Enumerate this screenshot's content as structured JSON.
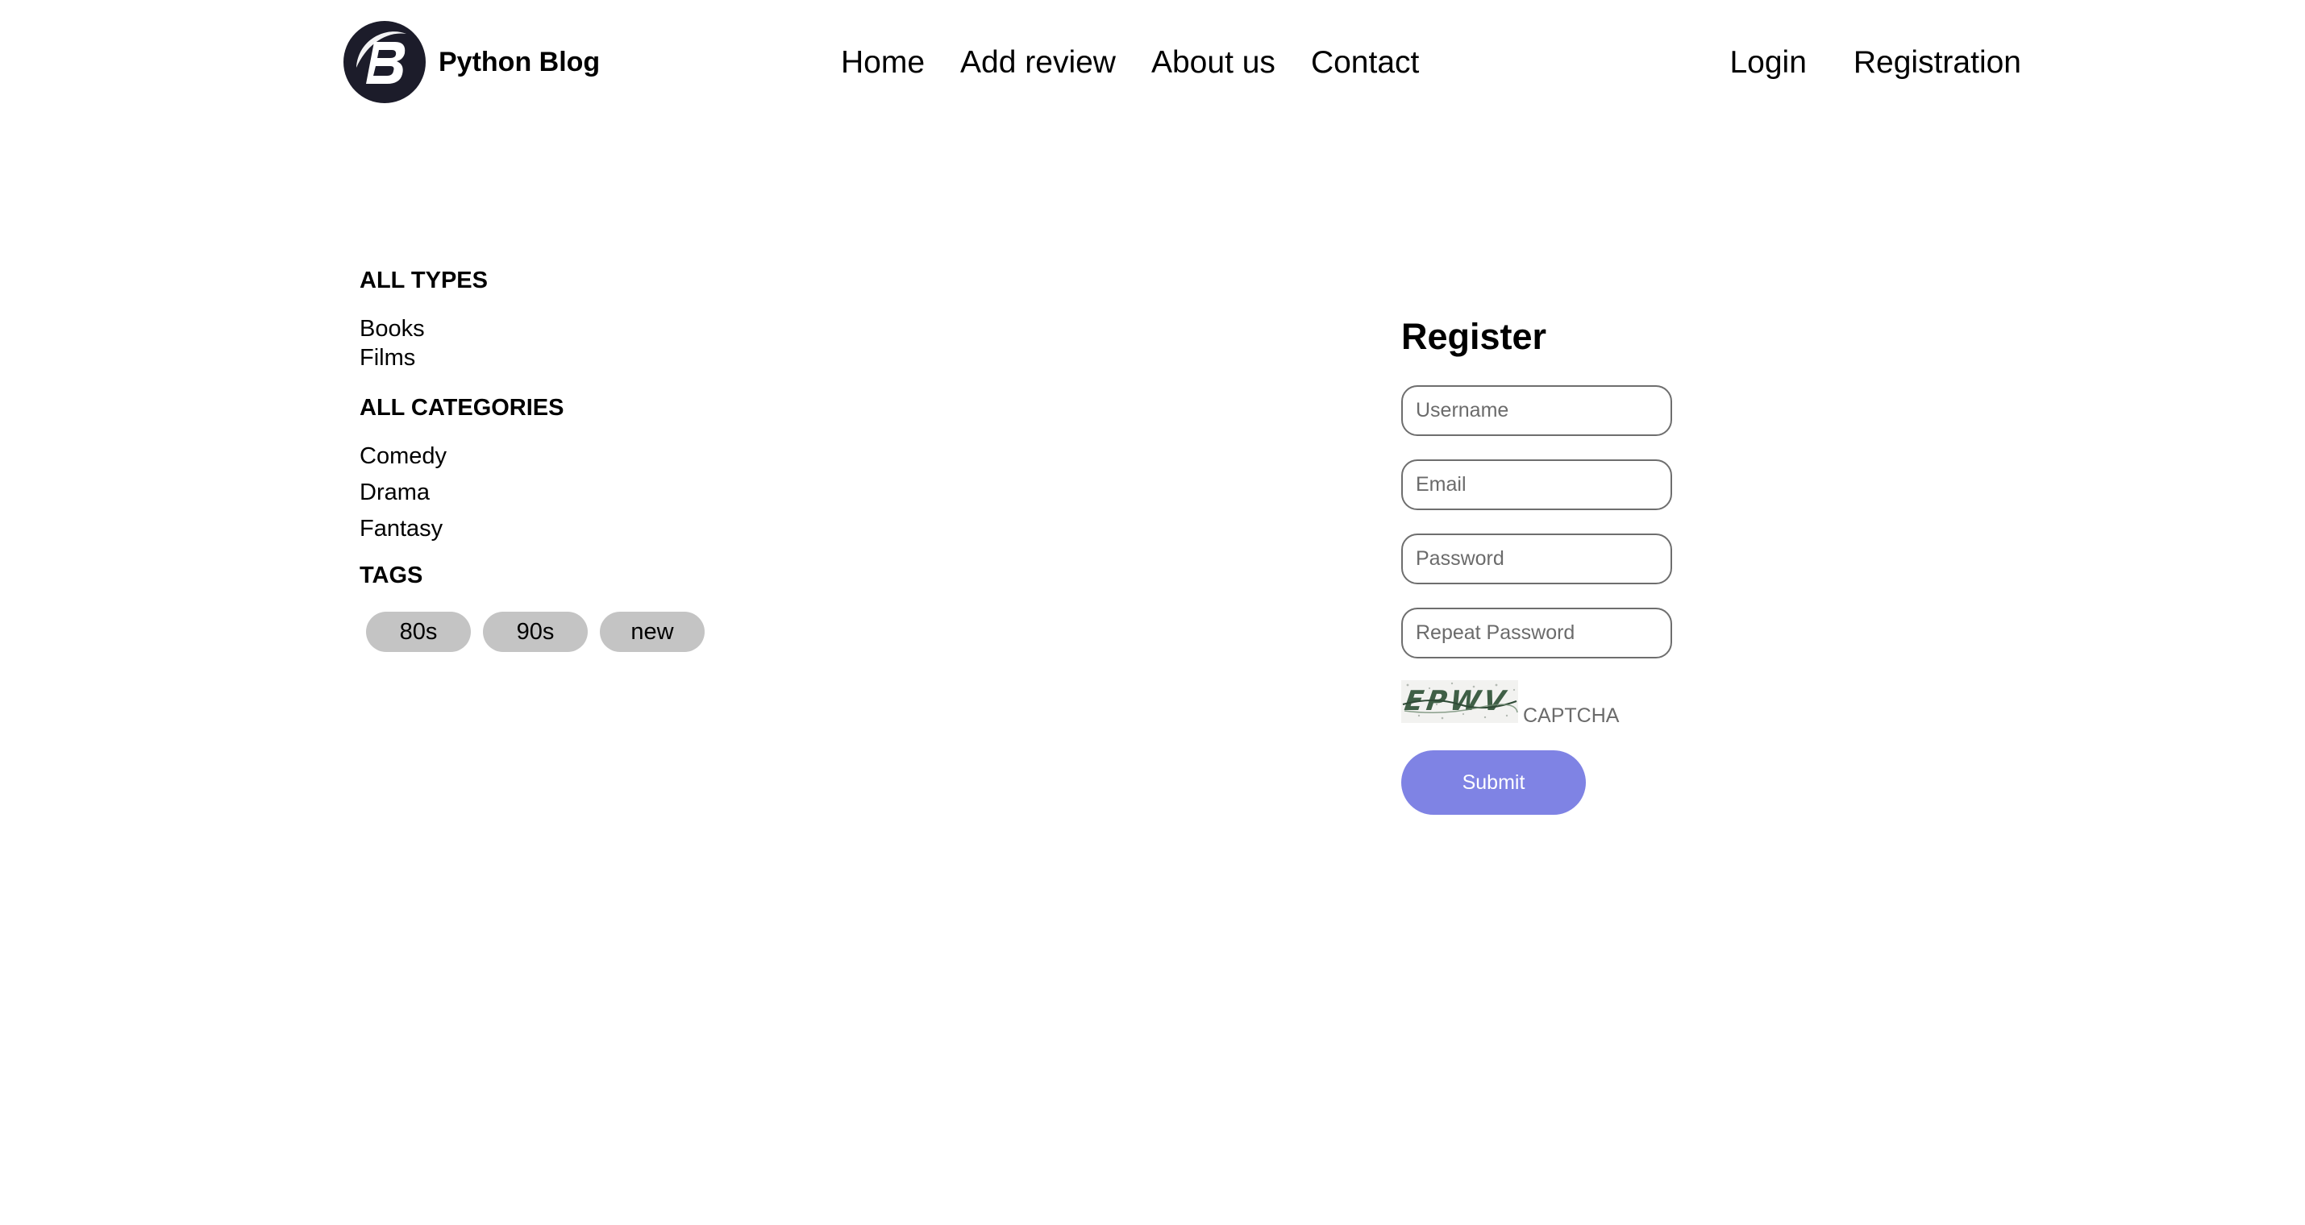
{
  "header": {
    "brand_name": "Python Blog",
    "logo_icon": "letter-b-logo-icon",
    "nav": [
      {
        "label": "Home"
      },
      {
        "label": "Add review"
      },
      {
        "label": "About us"
      },
      {
        "label": "Contact"
      }
    ],
    "auth": {
      "login_label": "Login",
      "registration_label": "Registration"
    }
  },
  "sidebar": {
    "types_heading": "ALL TYPES",
    "types": [
      {
        "label": "Books"
      },
      {
        "label": "Films"
      }
    ],
    "categories_heading": "ALL CATEGORIES",
    "categories": [
      {
        "label": "Comedy"
      },
      {
        "label": "Drama"
      },
      {
        "label": "Fantasy"
      }
    ],
    "tags_heading": "TAGS",
    "tags": [
      {
        "label": "80s"
      },
      {
        "label": "90s"
      },
      {
        "label": "new"
      }
    ]
  },
  "register": {
    "title": "Register",
    "username": {
      "value": "",
      "placeholder": "Username"
    },
    "email": {
      "value": "",
      "placeholder": "Email"
    },
    "password": {
      "value": "",
      "placeholder": "Password"
    },
    "repeat_password": {
      "value": "",
      "placeholder": "Repeat Password"
    },
    "captcha_text": "EPWV",
    "captcha_label": "CAPTCHA",
    "submit_label": "Submit"
  },
  "colors": {
    "accent": "#7f83e4",
    "tag_bg": "#c4c4c4",
    "logo_dark": "#1c1c2a"
  }
}
